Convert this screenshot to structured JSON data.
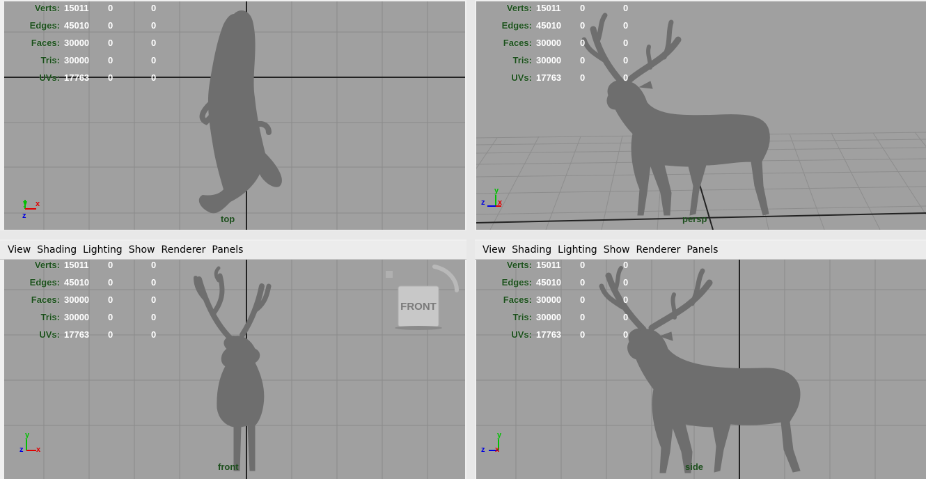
{
  "hud_labels": [
    "Verts:",
    "Edges:",
    "Faces:",
    "Tris:",
    "UVs:"
  ],
  "hud_values": [
    [
      "15011",
      "0",
      "0"
    ],
    [
      "45010",
      "0",
      "0"
    ],
    [
      "30000",
      "0",
      "0"
    ],
    [
      "30000",
      "0",
      "0"
    ],
    [
      "17763",
      "0",
      "0"
    ]
  ],
  "viewports": {
    "top": {
      "camera": "top"
    },
    "persp": {
      "camera": "persp"
    },
    "front": {
      "camera": "front"
    },
    "side": {
      "camera": "side"
    }
  },
  "menu": [
    "View",
    "Shading",
    "Lighting",
    "Show",
    "Renderer",
    "Panels"
  ],
  "viewcube_label": "FRONT",
  "axes": {
    "x": "x",
    "y": "y",
    "z": "z"
  },
  "colors": {
    "viewport_bg": "#a0a0a0",
    "grid": "#7f7f7f",
    "axis_x": "#e00000",
    "axis_y": "#00c000",
    "axis_z": "#0000e0",
    "model": "#6e6e6e"
  }
}
